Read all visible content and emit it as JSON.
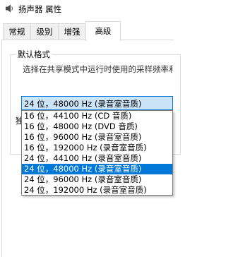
{
  "window": {
    "title": "扬声器 属性"
  },
  "tabs": [
    {
      "label": "常规"
    },
    {
      "label": "级别"
    },
    {
      "label": "增强"
    },
    {
      "label": "高级"
    }
  ],
  "active_tab": "高级",
  "default_format": {
    "group_label": "默认格式",
    "description": "选择在共享模式中运行时使用的采样频率和位深",
    "selected_value": "24 位，48000 Hz (录音室音质)",
    "options": [
      "16 位，44100 Hz (CD 音质)",
      "16 位，48000 Hz (DVD 音质)",
      "16 位，96000 Hz (录音室音质)",
      "16 位，192000 Hz (录音室音质)",
      "24 位，44100 Hz (录音室音质)",
      "24 位，48000 Hz (录音室音质)",
      "24 位，96000 Hz (录音室音质)",
      "24 位，192000 Hz (录音室音质)"
    ],
    "highlighted_index": 5
  },
  "exclusive_label_fragment": "独"
}
